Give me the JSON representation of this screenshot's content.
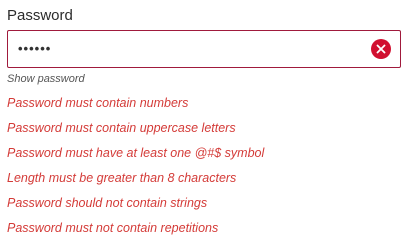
{
  "field": {
    "label": "Password",
    "value": "••••••",
    "clear_icon": "close-circle-icon"
  },
  "show_password_label": "Show password",
  "errors": [
    "Password must contain numbers",
    "Password must contain uppercase letters",
    "Password must have at least one @#$ symbol",
    "Length must be greater than 8 characters",
    "Password should not contain strings",
    "Password must not contain repetitions"
  ],
  "colors": {
    "border": "#a01a3c",
    "error_text": "#d43b38",
    "clear_icon": "#d10f2f"
  }
}
